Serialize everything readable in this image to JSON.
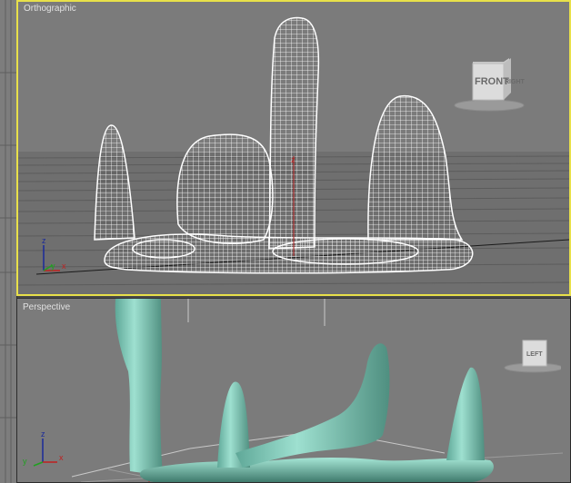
{
  "viewports": {
    "top": {
      "label": "Orthographic",
      "active": true
    },
    "bottom": {
      "label": "Perspective",
      "active": false
    }
  },
  "viewcube": {
    "top": {
      "face": "FRONT",
      "side": "RIGHT"
    },
    "bottom": {
      "face": "LEFT"
    }
  },
  "axes": {
    "z": "z",
    "y": "y",
    "x": "x"
  },
  "colors": {
    "active_border": "#e8e04a",
    "viewport_bg": "#7b7b7b",
    "wireframe": "#ffffff",
    "mesh": "#8fd3c3"
  }
}
